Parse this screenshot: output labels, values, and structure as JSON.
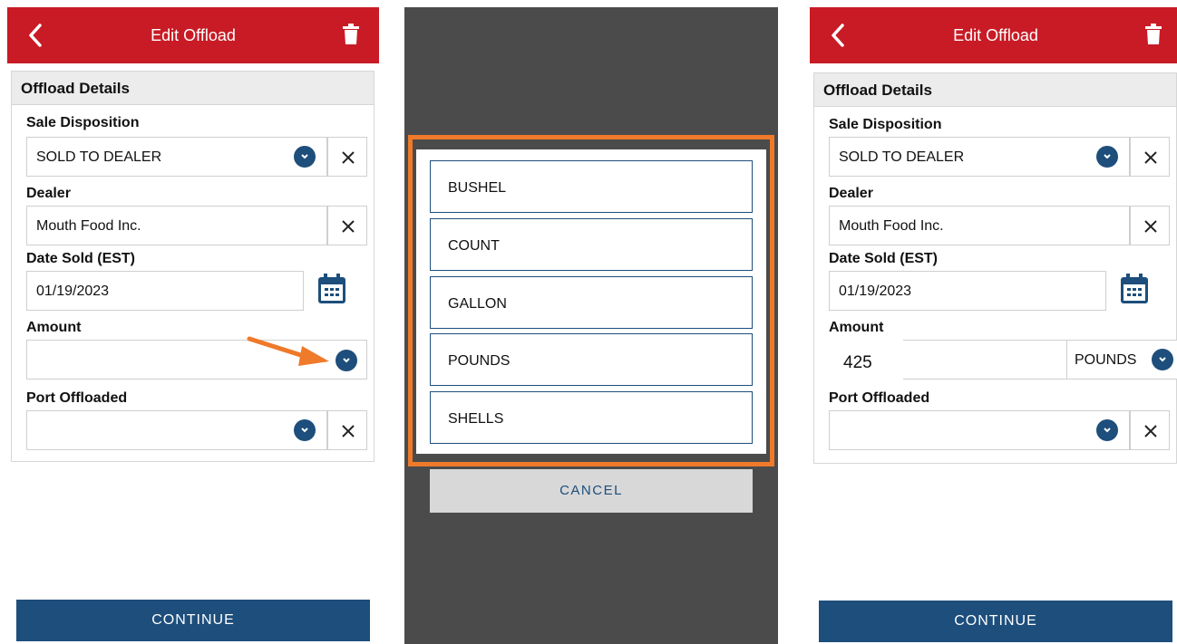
{
  "header": {
    "title": "Edit Offload"
  },
  "section_title": "Offload Details",
  "fields": {
    "sale_disposition": {
      "label": "Sale Disposition",
      "value": "SOLD TO DEALER"
    },
    "dealer": {
      "label": "Dealer",
      "value": "Mouth Food Inc."
    },
    "date_sold": {
      "label": "Date Sold (EST)",
      "value": "01/19/2023"
    },
    "amount": {
      "label": "Amount",
      "value_before": "",
      "value_after": "425",
      "unit_after": "POUNDS"
    },
    "port_offloaded": {
      "label": "Port Offloaded",
      "value": ""
    }
  },
  "unit_options": [
    "BUSHEL",
    "COUNT",
    "GALLON",
    "POUNDS",
    "SHELLS"
  ],
  "cancel_label": "CANCEL",
  "continue_label": "CONTINUE",
  "colors": {
    "header_red": "#c81b25",
    "primary_blue": "#1d4e7c",
    "highlight_orange": "#ee7a2a",
    "overlay_gray": "#4b4b4b"
  },
  "icons": [
    "back-arrow-icon",
    "trash-icon",
    "chevron-down-icon",
    "close-icon",
    "calendar-icon",
    "pointer-arrow-icon"
  ]
}
